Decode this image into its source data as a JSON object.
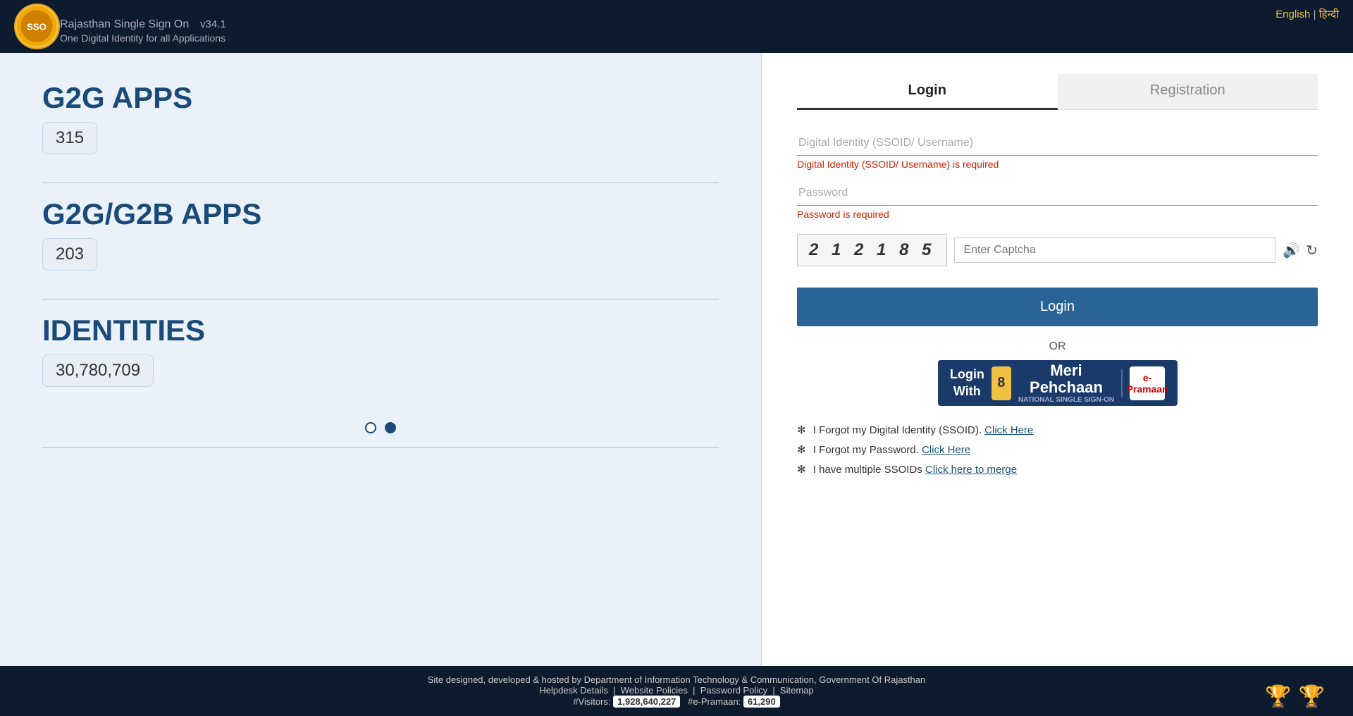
{
  "header": {
    "title": "Rajasthan Single Sign On",
    "version": "v34.1",
    "subtitle": "One Digital Identity for all Applications",
    "lang_english": "English",
    "lang_hindi": "हिन्दी",
    "lang_separator": "|"
  },
  "left_panel": {
    "g2g_label": "G2G APPS",
    "g2g_count": "315",
    "g2gb_label": "G2G/G2B APPS",
    "g2gb_count": "203",
    "identities_label": "IDENTITIES",
    "identities_count": "30,780,709"
  },
  "login_panel": {
    "tab_login": "Login",
    "tab_registration": "Registration",
    "ssoid_placeholder": "Digital Identity (SSOID/ Username)",
    "ssoid_error": "Digital Identity (SSOID/ Username) is required",
    "password_placeholder": "Password",
    "password_error": "Password is required",
    "captcha_text": "2  1  2  1  8  5",
    "captcha_placeholder": "Enter Captcha",
    "login_button": "Login",
    "or_text": "OR",
    "pehchaan_login_with": "Login",
    "pehchaan_with": "With",
    "pehchaan_meri": "Meri",
    "pehchaan_brand": "Pehchaan",
    "pehchaan_subtitle": "NATIONAL SINGLE SIGN-ON",
    "epramaan": "e-Pramaan",
    "forgot_ssoid_text": "I Forgot my Digital Identity (SSOID).",
    "forgot_ssoid_link": "Click Here",
    "forgot_password_text": "I Forgot my Password.",
    "forgot_password_link": "Click Here",
    "merge_text": "I have multiple SSOIDs",
    "merge_link": "Click here to merge"
  },
  "footer": {
    "designed_by": "Site designed, developed & hosted by Department of Information Technology & Communication, Government Of Rajasthan",
    "helpdesk": "Helpdesk Details",
    "website_policies": "Website Policies",
    "password_policy": "Password Policy",
    "sitemap": "Sitemap",
    "visitors_label": "#Visitors:",
    "visitors_count": "1,928,640,227",
    "epramaan_label": "#e-Pramaan:",
    "epramaan_count": "61,290"
  }
}
